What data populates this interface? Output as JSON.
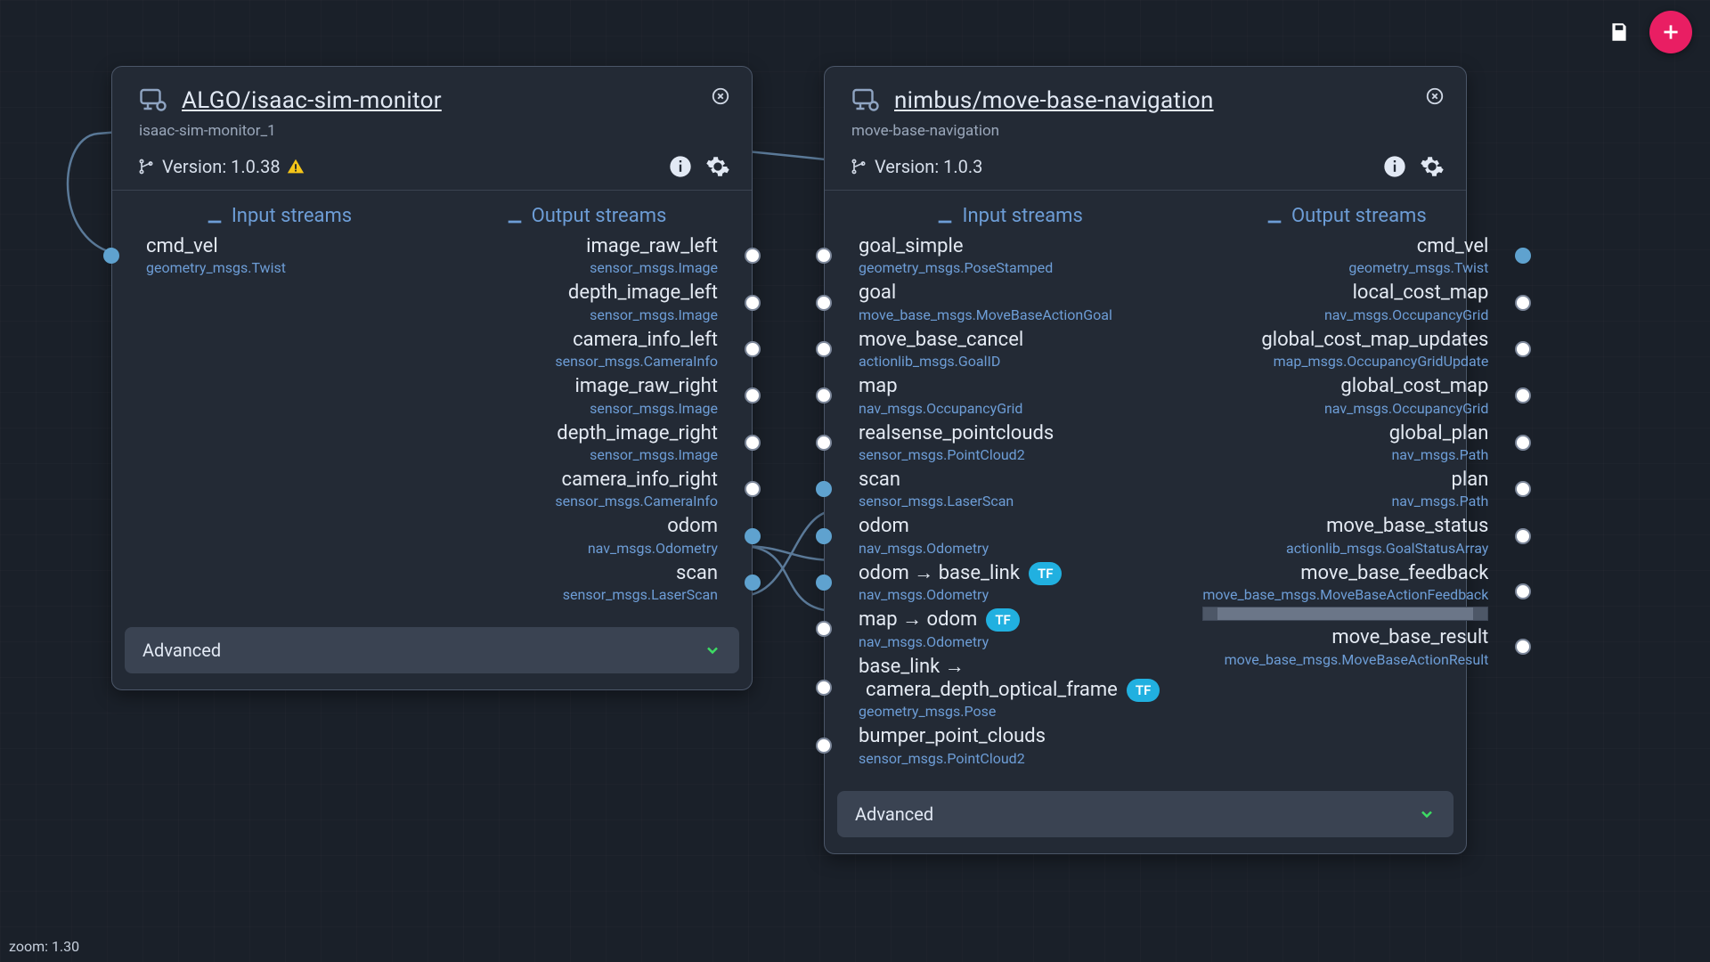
{
  "zoom_label": "zoom: 1.30",
  "colors": {
    "accent_pink": "#e91e63",
    "link": "#6d9dd6",
    "tf_badge": "#21b0e0",
    "chevron": "#3ddc64"
  },
  "labels": {
    "input_streams": "Input streams",
    "output_streams": "Output streams",
    "advanced": "Advanced",
    "version_prefix": "Version:"
  },
  "nodes": [
    {
      "id": "isaac",
      "title": "ALGO/isaac-sim-monitor",
      "subtitle": "isaac-sim-monitor_1",
      "version": "1.0.38",
      "has_warning": true,
      "inputs": [
        {
          "name": "cmd_vel",
          "type": "geometry_msgs.Twist",
          "connected": true
        }
      ],
      "outputs": [
        {
          "name": "image_raw_left",
          "type": "sensor_msgs.Image",
          "connected": false
        },
        {
          "name": "depth_image_left",
          "type": "sensor_msgs.Image",
          "connected": false
        },
        {
          "name": "camera_info_left",
          "type": "sensor_msgs.CameraInfo",
          "connected": false
        },
        {
          "name": "image_raw_right",
          "type": "sensor_msgs.Image",
          "connected": false
        },
        {
          "name": "depth_image_right",
          "type": "sensor_msgs.Image",
          "connected": false
        },
        {
          "name": "camera_info_right",
          "type": "sensor_msgs.CameraInfo",
          "connected": false
        },
        {
          "name": "odom",
          "type": "nav_msgs.Odometry",
          "connected": true
        },
        {
          "name": "scan",
          "type": "sensor_msgs.LaserScan",
          "connected": true
        }
      ]
    },
    {
      "id": "movebase",
      "title": "nimbus/move-base-navigation",
      "subtitle": "move-base-navigation",
      "version": "1.0.3",
      "has_warning": false,
      "inputs": [
        {
          "name": "goal_simple",
          "type": "geometry_msgs.PoseStamped",
          "connected": false
        },
        {
          "name": "goal",
          "type": "move_base_msgs.MoveBaseActionGoal",
          "connected": false
        },
        {
          "name": "move_base_cancel",
          "type": "actionlib_msgs.GoalID",
          "connected": false
        },
        {
          "name": "map",
          "type": "nav_msgs.OccupancyGrid",
          "connected": false
        },
        {
          "name": "realsense_pointclouds",
          "type": "sensor_msgs.PointCloud2",
          "connected": false
        },
        {
          "name": "scan",
          "type": "sensor_msgs.LaserScan",
          "connected": true
        },
        {
          "name": "odom",
          "type": "nav_msgs.Odometry",
          "connected": true
        },
        {
          "name": "odom  →  base_link",
          "type": "nav_msgs.Odometry",
          "tf": true,
          "connected": true
        },
        {
          "name": "map  →  odom",
          "type": "nav_msgs.Odometry",
          "tf": true,
          "connected": false
        },
        {
          "name": "base_link  →  camera_depth_optical_frame",
          "type": "geometry_msgs.Pose",
          "tf": true,
          "connected": false,
          "multiline": true
        },
        {
          "name": "bumper_point_clouds",
          "type": "sensor_msgs.PointCloud2",
          "connected": false
        }
      ],
      "outputs": [
        {
          "name": "cmd_vel",
          "type": "geometry_msgs.Twist",
          "connected": true
        },
        {
          "name": "local_cost_map",
          "type": "nav_msgs.OccupancyGrid",
          "connected": false
        },
        {
          "name": "global_cost_map_updates",
          "type": "map_msgs.OccupancyGridUpdate",
          "connected": false
        },
        {
          "name": "global_cost_map",
          "type": "nav_msgs.OccupancyGrid",
          "connected": false
        },
        {
          "name": "global_plan",
          "type": "nav_msgs.Path",
          "connected": false
        },
        {
          "name": "plan",
          "type": "nav_msgs.Path",
          "connected": false
        },
        {
          "name": "move_base_status",
          "type": "actionlib_msgs.GoalStatusArray",
          "connected": false
        },
        {
          "name": "move_base_feedback",
          "type": "move_base_msgs.MoveBaseActionFeedback",
          "connected": false,
          "overflow": true
        },
        {
          "name": "move_base_result",
          "type": "move_base_msgs.MoveBaseActionResult",
          "connected": false
        }
      ]
    }
  ],
  "connections": [
    {
      "from": [
        "isaac",
        "out",
        "odom"
      ],
      "to": [
        "movebase",
        "in",
        "odom"
      ]
    },
    {
      "from": [
        "isaac",
        "out",
        "odom"
      ],
      "to": [
        "movebase",
        "in",
        "odom  →  base_link"
      ]
    },
    {
      "from": [
        "isaac",
        "out",
        "scan"
      ],
      "to": [
        "movebase",
        "in",
        "scan"
      ]
    },
    {
      "from": [
        "movebase",
        "out",
        "cmd_vel"
      ],
      "to": [
        "isaac",
        "in",
        "cmd_vel"
      ],
      "long_route": true
    }
  ]
}
